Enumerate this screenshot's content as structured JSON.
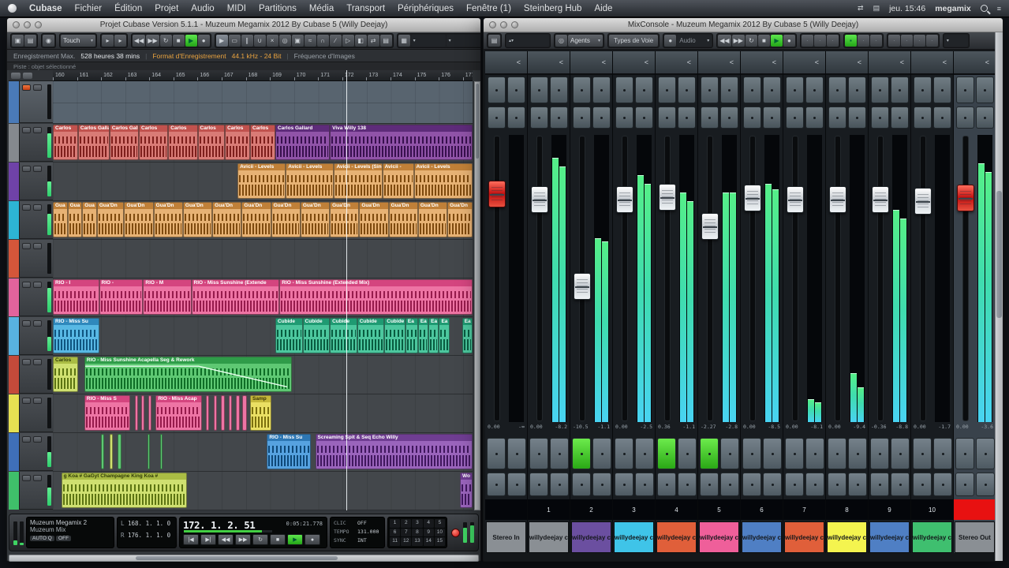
{
  "menu_bar": {
    "items": [
      "Cubase",
      "Fichier",
      "Édition",
      "Projet",
      "Audio",
      "MIDI",
      "Partitions",
      "Média",
      "Transport",
      "Périphériques",
      "Fenêtre (1)",
      "Steinberg Hub",
      "Aide"
    ],
    "clock": "jeu. 15:46",
    "user": "megamix"
  },
  "project_window": {
    "title": "Projet Cubase Version 5.1.1 - Muzeum Megamix 2012 By Cubase 5 (Willy Deejay)",
    "toolbar": {
      "automation_mode": "Touch",
      "tools": [
        "▶",
        "▭",
        "∥",
        "∪",
        "×",
        "◎",
        "▣",
        "≈",
        "∩",
        "∕",
        "▷",
        "◧",
        "⇄",
        "▤"
      ],
      "transport_icons": [
        "◀◀",
        "▶▶",
        "↻",
        "■",
        "▶",
        "●"
      ]
    },
    "info_bar": {
      "rec_label": "Enregistrement Max.",
      "rec_value": "528 heures 38 mins",
      "fmt_label": "Format d'Enregistrement",
      "fmt_value": "44.1 kHz - 24 Bit",
      "fps_label": "Fréquence d'Images",
      "sep": "|"
    },
    "status_line": "Piste : objet sélectionné",
    "ruler": {
      "start": 160,
      "count": 18
    },
    "playhead_pct": 70,
    "tracks": [
      {
        "color": "#4a7ab8",
        "selected": true,
        "meter": 0,
        "clips": []
      },
      {
        "color": "#85898e",
        "selected": false,
        "meter": 0.8,
        "clips": [
          [
            0,
            6,
            "red",
            "Carlos"
          ],
          [
            6,
            7.5,
            "red",
            "Carlos Gallardo feat K"
          ],
          [
            13.5,
            7,
            "red",
            "Carlos Gallardi"
          ],
          [
            20.5,
            7,
            "red",
            "Carlos"
          ],
          [
            27.5,
            7,
            "red",
            "Carlos"
          ],
          [
            34.5,
            6.5,
            "red",
            "Carlos"
          ],
          [
            41,
            6,
            "red",
            "Carlos"
          ],
          [
            47,
            6,
            "red",
            "Carlos"
          ],
          [
            53,
            13,
            "darkpurple",
            "Carlos Gallard"
          ],
          [
            66,
            34,
            "darkpurple",
            "Viva Willy 138"
          ]
        ]
      },
      {
        "color": "#6f42a8",
        "selected": false,
        "meter": 0.5,
        "clips": [
          [
            44,
            11.5,
            "orange",
            "Avicii - Levels"
          ],
          [
            55.5,
            11.5,
            "orange",
            "Avicii - Levels"
          ],
          [
            67,
            11.5,
            "orange",
            "Avicii - Levels (Single"
          ],
          [
            78.5,
            7.5,
            "orange",
            "Avicii -"
          ],
          [
            86,
            14,
            "orange",
            "Avicii - Levels"
          ]
        ]
      },
      {
        "color": "#2db4d4",
        "selected": false,
        "meter": 0.7,
        "clips": [
          [
            0,
            3.5,
            "orange",
            "Gua"
          ],
          [
            3.5,
            3.5,
            "orange",
            "Gua"
          ],
          [
            7,
            3.5,
            "orange",
            "Gua"
          ],
          [
            10.5,
            6.5,
            "orange",
            "Gua'Dn"
          ],
          [
            17,
            7,
            "orange",
            "Gua'Dn"
          ],
          [
            24,
            7,
            "orange",
            "Gua'Dn"
          ],
          [
            31,
            7,
            "orange",
            "Gua'Dn"
          ],
          [
            38,
            7,
            "orange",
            "Gua'Dn"
          ],
          [
            45,
            7,
            "orange",
            "Gua'Dn"
          ],
          [
            52,
            7,
            "orange",
            "Gua'Dn"
          ],
          [
            59,
            7,
            "orange",
            "Gua'Dn"
          ],
          [
            66,
            7,
            "orange",
            "Gua'Dn"
          ],
          [
            73,
            7,
            "orange",
            "Gua'Dn"
          ],
          [
            80,
            7,
            "orange",
            "Gua'Dn"
          ],
          [
            87,
            7,
            "orange",
            "Gua'Dn"
          ],
          [
            94,
            6,
            "orange",
            "Gua'Dn"
          ]
        ]
      },
      {
        "color": "#d4563a",
        "selected": false,
        "meter": 0,
        "clips": []
      },
      {
        "color": "#e2639c",
        "selected": false,
        "meter": 0.8,
        "clips": [
          [
            0,
            11,
            "pink",
            "RIO - I"
          ],
          [
            11,
            10.5,
            "pink",
            "RIO -"
          ],
          [
            21.5,
            11.5,
            "pink",
            "RIO - M"
          ],
          [
            33,
            21,
            "pink",
            "RIO - Miss Sunshine (Extende"
          ],
          [
            54,
            46,
            "pink",
            "RIO - Miss Sunshine (Extended Mix)"
          ]
        ]
      },
      {
        "color": "#58b2e0",
        "selected": false,
        "meter": 0.45,
        "clips": [
          [
            0,
            11,
            "cyan",
            "RIO - Miss Su"
          ],
          [
            53,
            6.5,
            "teal",
            "Cubide"
          ],
          [
            59.5,
            6.5,
            "teal",
            "Cubide"
          ],
          [
            66,
            6.5,
            "teal",
            "Cubide"
          ],
          [
            72.5,
            6.5,
            "teal",
            "Cubide"
          ],
          [
            79,
            5,
            "teal",
            "Cubide"
          ],
          [
            84,
            3,
            "teal",
            "Ea"
          ],
          [
            87,
            2.5,
            "teal",
            "Ea"
          ],
          [
            89.5,
            2.5,
            "teal",
            "Ea"
          ],
          [
            92,
            2.5,
            "teal",
            "Ea"
          ],
          [
            97.5,
            2.5,
            "teal",
            "Ea"
          ]
        ]
      },
      {
        "color": "#c44a3a",
        "selected": false,
        "meter": 0,
        "clips": [
          [
            0,
            6,
            "yg",
            "Carlos"
          ],
          [
            7.5,
            49.5,
            "green",
            "RIO - Miss Sunshine Acapella Seg & Rework",
            true
          ]
        ]
      },
      {
        "color": "#e6e052",
        "selected": false,
        "meter": 0,
        "clips": [
          [
            7.5,
            11,
            "pink",
            "RIO - Miss S"
          ],
          [
            19.5,
            0.8,
            "pink",
            ""
          ],
          [
            21,
            0.8,
            "pink",
            ""
          ],
          [
            22.7,
            0.8,
            "pink",
            ""
          ],
          [
            24.5,
            11,
            "pink",
            "RIO - Miss Acap"
          ],
          [
            36.5,
            0.8,
            "pink",
            ""
          ],
          [
            38.3,
            0.8,
            "pink",
            ""
          ],
          [
            40.1,
            0.8,
            "pink",
            ""
          ],
          [
            41.9,
            0.8,
            "pink",
            ""
          ],
          [
            43.7,
            0.8,
            "pink",
            ""
          ],
          [
            45.2,
            1,
            "pink",
            ""
          ],
          [
            47,
            5,
            "yellow",
            "Samp"
          ]
        ]
      },
      {
        "color": "#3f6fb8",
        "selected": false,
        "meter": 0.5,
        "clips": [
          [
            11.5,
            0.8,
            "green",
            ""
          ],
          [
            13.5,
            0.8,
            "yg",
            ""
          ],
          [
            15.5,
            0.8,
            "green",
            ""
          ],
          [
            22.5,
            0.7,
            "green",
            ""
          ],
          [
            25.5,
            0.7,
            "green",
            ""
          ],
          [
            51,
            10.5,
            "blue",
            "RIO - Miss Su"
          ],
          [
            62.5,
            37.5,
            "purple",
            "Screaming Spit & Seq Echo Willy"
          ]
        ]
      },
      {
        "color": "#3fbf6a",
        "selected": false,
        "meter": 0.6,
        "clips": [
          [
            2,
            30,
            "yg",
            "g Koa # GaGyt Champagne King Koa #"
          ],
          [
            97,
            3,
            "purple",
            "Wo"
          ]
        ]
      }
    ],
    "transport": {
      "display_line1": "Muzeum Megamix 2",
      "display_line2": "Muzeum Mix",
      "auto_q": "AUTO Q",
      "auto_q_state": "OFF",
      "loc_l_label": "L",
      "loc_l": "168. 1. 1.  0",
      "loc_r_label": "R",
      "loc_r": "176. 1. 1.  0",
      "time_primary": "172. 1. 2. 51",
      "time_secondary": "0:05:21.778",
      "click_label": "CLIC",
      "click_state": "OFF",
      "tempo_label": "TEMPO",
      "tempo_value": "131.000",
      "sync_label": "SYNC",
      "sync_value": "INT",
      "markers": [
        "1",
        "2",
        "3",
        "4",
        "5",
        "6",
        "7",
        "8",
        "9",
        "10",
        "11",
        "12",
        "13",
        "14",
        "15"
      ]
    }
  },
  "clip_colors": {
    "red": {
      "bg": "#d97b76",
      "lab": "#c1524e",
      "wav": "#7e1f1c",
      "txt": "#ffffff"
    },
    "darkpurple": {
      "bg": "#9053a8",
      "lab": "#5e2b7a",
      "wav": "#38104e",
      "txt": "#ffffff"
    },
    "orange": {
      "bg": "#e7b274",
      "lab": "#c08038",
      "wav": "#7e4a0e",
      "txt": "#ffffff"
    },
    "pink": {
      "bg": "#ee74a4",
      "lab": "#d4457f",
      "wav": "#961b4c",
      "txt": "#ffffff"
    },
    "cyan": {
      "bg": "#58b8e4",
      "lab": "#2f88bc",
      "wav": "#0f5580",
      "txt": "#ffffff"
    },
    "teal": {
      "bg": "#4cc79e",
      "lab": "#1f9a72",
      "wav": "#085c40",
      "txt": "#ffffff"
    },
    "green": {
      "bg": "#5ec873",
      "lab": "#2f9c49",
      "wav": "#0e6e26",
      "txt": "#ffffff"
    },
    "yg": {
      "bg": "#cfe070",
      "lab": "#aabc44",
      "wav": "#5c7412",
      "txt": "#2f3a08"
    },
    "yellow": {
      "bg": "#eadf63",
      "lab": "#c6b83a",
      "wav": "#7c700e",
      "txt": "#3a3408"
    },
    "blue": {
      "bg": "#56a2e0",
      "lab": "#2d77b4",
      "wav": "#0e4878",
      "txt": "#ffffff"
    },
    "purple": {
      "bg": "#9a64bc",
      "lab": "#6f3d92",
      "wav": "#40175e",
      "txt": "#ffffff"
    }
  },
  "mixer_window": {
    "title": "MixConsole - Muzeum Megamix 2012 By Cubase 5 (Willy Deejay)",
    "toolbar": {
      "agents": "Agents",
      "channel_types": "Types de Voie",
      "racks": "Audio",
      "transport_icons": [
        "◀◀",
        "▶▶",
        "↻",
        "■",
        "▶",
        "●"
      ]
    },
    "rack_collapse_icon": "<",
    "channels": [
      {
        "name": "Stereo In",
        "number": "",
        "color": "#8a8f94",
        "fader": "red",
        "fader_y": 0.176,
        "meters": [
          0,
          0
        ],
        "db": "0.00",
        "peak": "-∞",
        "mon": false,
        "clip": false
      },
      {
        "name": "willydeejay c",
        "number": "1",
        "color": "#8a8f94",
        "fader": "white",
        "fader_y": 0.197,
        "meters": [
          0.92,
          0.89
        ],
        "db": "0.00",
        "peak": "-8.2",
        "mon": false,
        "clip": false
      },
      {
        "name": "willydeejay c",
        "number": "2",
        "color": "#6b4fa0",
        "fader": "white",
        "fader_y": 0.53,
        "meters": [
          0.64,
          0.63
        ],
        "db": "-10.5",
        "peak": "-1.1",
        "mon": true,
        "clip": false
      },
      {
        "name": "willydeejay c",
        "number": "3",
        "color": "#3fc4e8",
        "fader": "white",
        "fader_y": 0.197,
        "meters": [
          0.86,
          0.83
        ],
        "db": "0.00",
        "peak": "-2.5",
        "mon": false,
        "clip": false
      },
      {
        "name": "willydeejay c",
        "number": "4",
        "color": "#e05f3a",
        "fader": "white",
        "fader_y": 0.188,
        "meters": [
          0.8,
          0.77
        ],
        "db": "0.36",
        "peak": "-1.1",
        "mon": true,
        "clip": false
      },
      {
        "name": "willydeejay c",
        "number": "5",
        "color": "#ef5f9a",
        "fader": "white",
        "fader_y": 0.3,
        "meters": [
          0.8,
          0.8
        ],
        "db": "-2.27",
        "peak": "-2.8",
        "mon": true,
        "clip": false
      },
      {
        "name": "willydeejay c",
        "number": "6",
        "color": "#4f7fc4",
        "fader": "white",
        "fader_y": 0.19,
        "meters": [
          0.83,
          0.81
        ],
        "db": "0.00",
        "peak": "-8.5",
        "mon": false,
        "clip": false
      },
      {
        "name": "willydeejay c",
        "number": "7",
        "color": "#e05f3a",
        "fader": "white",
        "fader_y": 0.197,
        "meters": [
          0.08,
          0.07
        ],
        "db": "0.00",
        "peak": "-8.1",
        "mon": false,
        "clip": false
      },
      {
        "name": "willydeejay c",
        "number": "8",
        "color": "#f4f44f",
        "fader": "white",
        "fader_y": 0.197,
        "meters": [
          0.17,
          0.12
        ],
        "db": "0.00",
        "peak": "-9.4",
        "mon": false,
        "clip": false
      },
      {
        "name": "willydeejay c",
        "number": "9",
        "color": "#4f7fc4",
        "fader": "white",
        "fader_y": 0.197,
        "meters": [
          0.74,
          0.71
        ],
        "db": "-0.36",
        "peak": "-8.8",
        "mon": false,
        "clip": false
      },
      {
        "name": "willydeejay c",
        "number": "10",
        "color": "#3fbf6f",
        "fader": "white",
        "fader_y": 0.203,
        "meters": [
          0,
          0
        ],
        "db": "0.00",
        "peak": "-1.7",
        "mon": false,
        "clip": false
      },
      {
        "name": "Stereo Out",
        "number": "",
        "color": "#8a8f94",
        "fader": "red",
        "fader_y": 0.19,
        "meters": [
          0.9,
          0.87
        ],
        "db": "0.00",
        "peak": "-3.6",
        "mon": false,
        "clip": true
      }
    ]
  }
}
